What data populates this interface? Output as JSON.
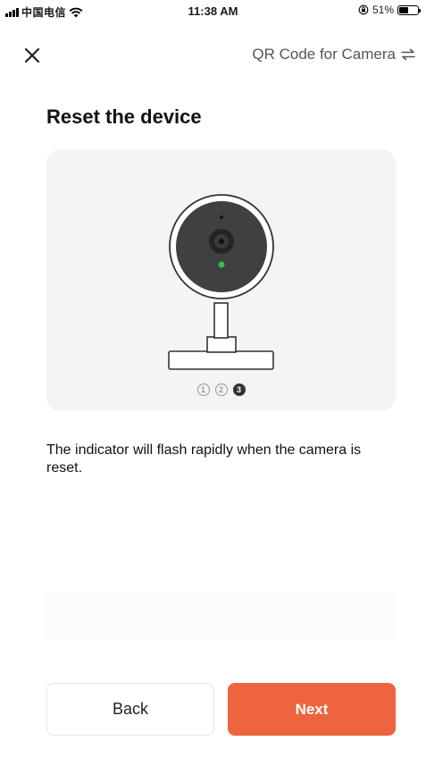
{
  "status_bar": {
    "carrier": "中国电信",
    "time": "11:38 AM",
    "battery_percent_label": "51%",
    "battery_level": 0.51,
    "icons": [
      "signal-icon",
      "wifi-icon",
      "orientation-lock-icon",
      "battery-icon"
    ]
  },
  "nav": {
    "close_icon": "close-icon",
    "mode_switch_label": "QR Code for Camera",
    "mode_switch_icon": "switch-arrows-icon"
  },
  "page": {
    "title": "Reset the device",
    "description": "The indicator will flash rapidly when the camera is reset."
  },
  "illustration": {
    "icon": "camera-illustration",
    "indicator_color": "#35c24a",
    "steps": [
      "1",
      "2",
      "3"
    ],
    "active_step": 3
  },
  "buttons": {
    "back_label": "Back",
    "next_label": "Next"
  },
  "colors": {
    "accent": "#ee643e",
    "card_background": "#f4f4f4"
  }
}
